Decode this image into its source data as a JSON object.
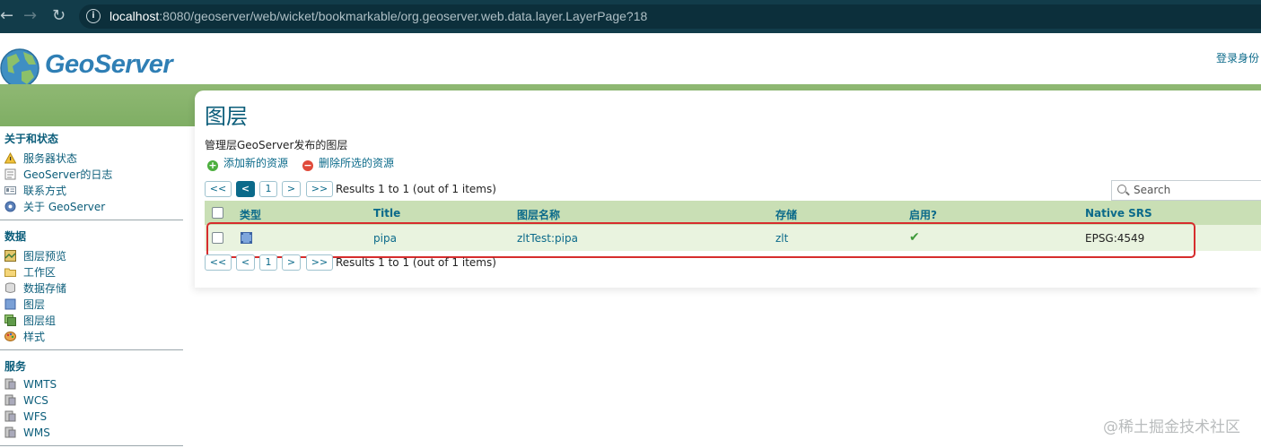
{
  "browser": {
    "url_host": "localhost",
    "url_rest": ":8080/geoserver/web/wicket/bookmarkable/org.geoserver.web.data.layer.LayerPage?18"
  },
  "header": {
    "logo_text": "GeoServer",
    "login_label": "登录身份"
  },
  "sidebar": {
    "sections": [
      {
        "title": "关于和状态",
        "items": [
          {
            "label": "服务器状态",
            "icon": "warning-icon"
          },
          {
            "label": "GeoServer的日志",
            "icon": "log-icon"
          },
          {
            "label": "联系方式",
            "icon": "contact-card-icon"
          },
          {
            "label": "关于 GeoServer",
            "icon": "info-icon"
          }
        ]
      },
      {
        "title": "数据",
        "items": [
          {
            "label": "图层预览",
            "icon": "map-preview-icon"
          },
          {
            "label": "工作区",
            "icon": "folder-icon"
          },
          {
            "label": "数据存储",
            "icon": "database-icon"
          },
          {
            "label": "图层",
            "icon": "layer-icon"
          },
          {
            "label": "图层组",
            "icon": "layer-group-icon"
          },
          {
            "label": "样式",
            "icon": "palette-icon"
          }
        ]
      },
      {
        "title": "服务",
        "items": [
          {
            "label": "WMTS",
            "icon": "server-icon"
          },
          {
            "label": "WCS",
            "icon": "server-icon"
          },
          {
            "label": "WFS",
            "icon": "server-icon"
          },
          {
            "label": "WMS",
            "icon": "server-icon"
          }
        ]
      }
    ]
  },
  "main": {
    "title": "图层",
    "description": "管理层GeoServer发布的图层",
    "add_label": "添加新的资源",
    "remove_label": "删除所选的资源",
    "pager": {
      "first": "<<",
      "prev": "<",
      "page": "1",
      "next": ">",
      "last": ">>",
      "results": "Results 1 to 1 (out of 1 items)"
    },
    "search_placeholder": "Search",
    "table": {
      "headers": {
        "type": "类型",
        "title": "Title",
        "name": "图层名称",
        "store": "存储",
        "enabled": "启用?",
        "srs": "Native SRS"
      },
      "rows": [
        {
          "title": "pipa",
          "name": "zltTest:pipa",
          "store": "zlt",
          "enabled": "✔",
          "srs": "EPSG:4549"
        }
      ]
    }
  },
  "watermark": "@稀土掘金技术社区",
  "colors": {
    "accent": "#0b6a8a",
    "green_band": "#8fb873",
    "highlight_border": "#d62d2d"
  }
}
